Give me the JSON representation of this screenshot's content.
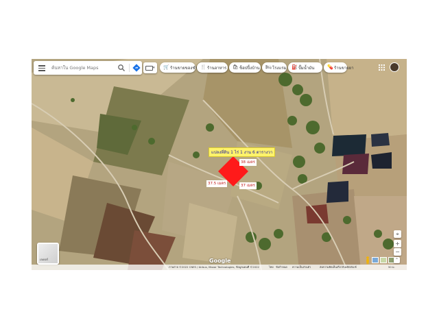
{
  "search": {
    "placeholder": "ค้นหาใน Google Maps"
  },
  "chips": [
    {
      "label": "ร้านขายของชำ",
      "icon": "cart-icon"
    },
    {
      "label": "ร้านอาหาร",
      "icon": "fork-knife-icon"
    },
    {
      "label": "ช็อปปิ้งบ้าน",
      "icon": "bag-icon"
    },
    {
      "label": "โรงแรม",
      "icon": "bed-icon"
    },
    {
      "label": "ปั๊มน้ำมัน",
      "icon": "fuel-icon"
    },
    {
      "label": "ร้านขายยา",
      "icon": "pill-icon"
    }
  ],
  "parcel": {
    "title": "แปลงที่ดิน 1 ไร่ 1 งาน 6 ตารางวา",
    "sides": [
      "38 เมตร",
      "37.5 เมตร",
      "37 เมตร",
      "38 เมตร"
    ],
    "color": "#ff1a1a"
  },
  "layers": {
    "label": "เลเยอร์"
  },
  "logo": "Google",
  "footer": {
    "imagery": "ภาพถ่าย ©2022 CNES / Airbus, Maxar Technologies, ข้อมูลแผนที่ ©2022",
    "country": "ไทย",
    "terms": "ข้อกำหนด",
    "privacy": "ความเป็นส่วนตัว",
    "feedback": "ส่งความคิดเห็นเกี่ยวกับผลิตภัณฑ์",
    "scale": "50 ม."
  },
  "colors": {
    "accent": "#1a73e8",
    "title_bg": "#fff36b",
    "title_text": "#1a1aa0",
    "label_text": "#c01818"
  }
}
